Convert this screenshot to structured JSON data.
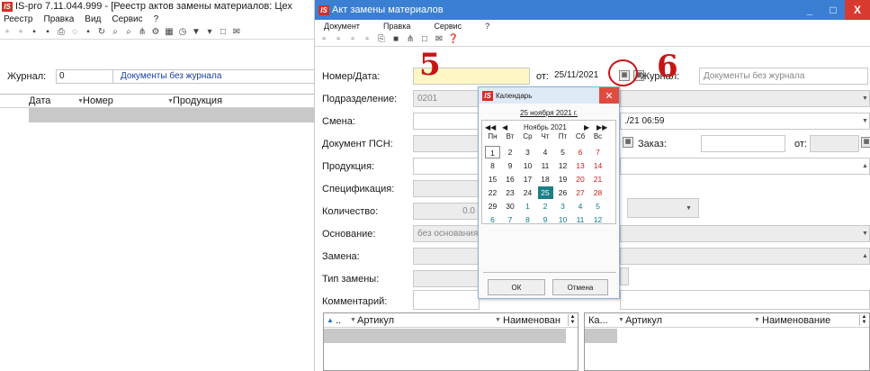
{
  "left_window": {
    "title": "IS-pro 7.11.044.999 - [Реестр актов замены материалов: Цех",
    "menu": [
      "Реестр",
      "Правка",
      "Вид",
      "Сервис",
      "?"
    ],
    "journal_label": "Журнал:",
    "journal_code": "0",
    "journal_name": "Документы без журнала",
    "columns": [
      "Дата",
      "Номер",
      "Продукция"
    ]
  },
  "main_window": {
    "title": "Акт замены материалов",
    "menu": [
      "Документ",
      "Правка",
      "Сервис",
      "?"
    ],
    "minimize": "_",
    "maximize": "□",
    "close": "X"
  },
  "form": {
    "number_date_label": "Номер/Дата:",
    "from_label": "от:",
    "date_value": "25/11/2021",
    "journal_label": "Журнал:",
    "journal_value": "Документы без журнала",
    "department_label": "Подразделение:",
    "department_value": "0201",
    "shift_label": "Смена:",
    "shift_value": "./21 06:59",
    "psn_label": "Документ ПСН:",
    "order_label": "Заказ:",
    "order_from_label": "от:",
    "product_label": "Продукция:",
    "spec_label": "Спецификация:",
    "qty_label": "Количество:",
    "qty_value": "0.0",
    "basis_label": "Основание:",
    "basis_value": "без основания",
    "replacement_label": "Замена:",
    "replacement_type_label": "Тип замены:",
    "comment_label": "Комментарий:"
  },
  "calendar": {
    "title": "Календарь",
    "today_link": "25 ноября 2021 г.",
    "month_label": "Ноябрь 2021",
    "nav_first": "◀◀",
    "nav_prev": "◀",
    "nav_next": "▶",
    "nav_last": "▶▶",
    "weekdays": [
      "Пн",
      "Вт",
      "Ср",
      "Чт",
      "Пт",
      "Сб",
      "Вс"
    ],
    "ok_label": "ОК",
    "cancel_label": "Отмена",
    "selected_day": 25,
    "accent_color": "#1a7f86",
    "weekend_color": "#d02020"
  },
  "annotations": {
    "step_5": "5",
    "step_6": "6",
    "color": "#c81414"
  },
  "bottom_grids": {
    "left_columns": [
      "..",
      "Артикул",
      "Наименован"
    ],
    "right_columns": [
      "Ка...",
      "Артикул",
      "Наименование"
    ]
  }
}
